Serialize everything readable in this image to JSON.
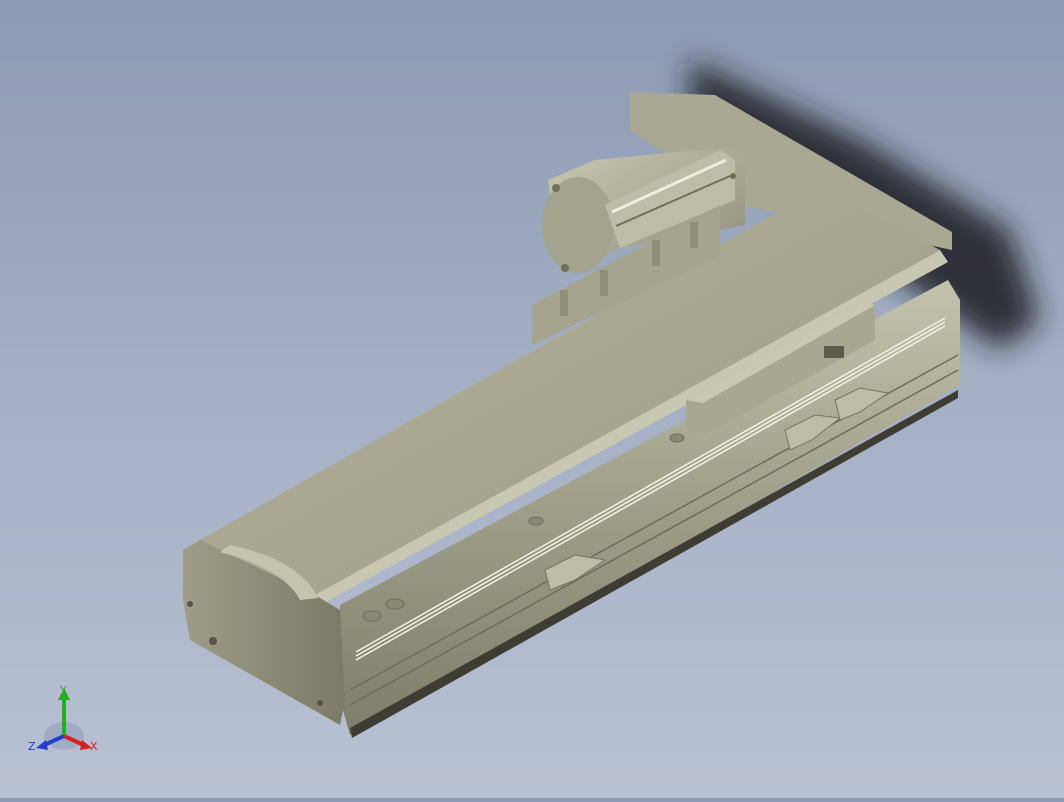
{
  "viewport": {
    "background_top": "#8c9ab3",
    "background_bottom": "#b9c1d3",
    "model_color": "#b6b49f"
  },
  "triad": {
    "x_label": "X",
    "y_label": "Y",
    "z_label": "Z",
    "x_color": "#d42020",
    "y_color": "#20b020",
    "z_color": "#2040d0"
  }
}
